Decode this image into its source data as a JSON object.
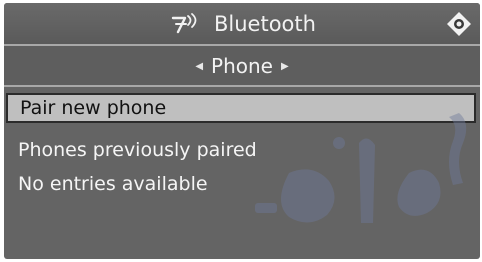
{
  "header": {
    "title": "Bluetooth",
    "icon": "bluetooth-icon",
    "controller_icon": "controller-icon"
  },
  "subbar": {
    "label": "Phone",
    "left_arrow_icon": "arrow-left-icon",
    "right_arrow_icon": "arrow-right-icon"
  },
  "menu": {
    "items": [
      {
        "label": "Pair new phone",
        "selected": true
      },
      {
        "label": "Phones previously paired",
        "selected": false
      },
      {
        "label": "No entries available",
        "selected": false
      }
    ]
  },
  "colors": {
    "screen_bg": "#646464",
    "selected_bg": "#bfbfbf",
    "text": "#f5f5f5"
  }
}
